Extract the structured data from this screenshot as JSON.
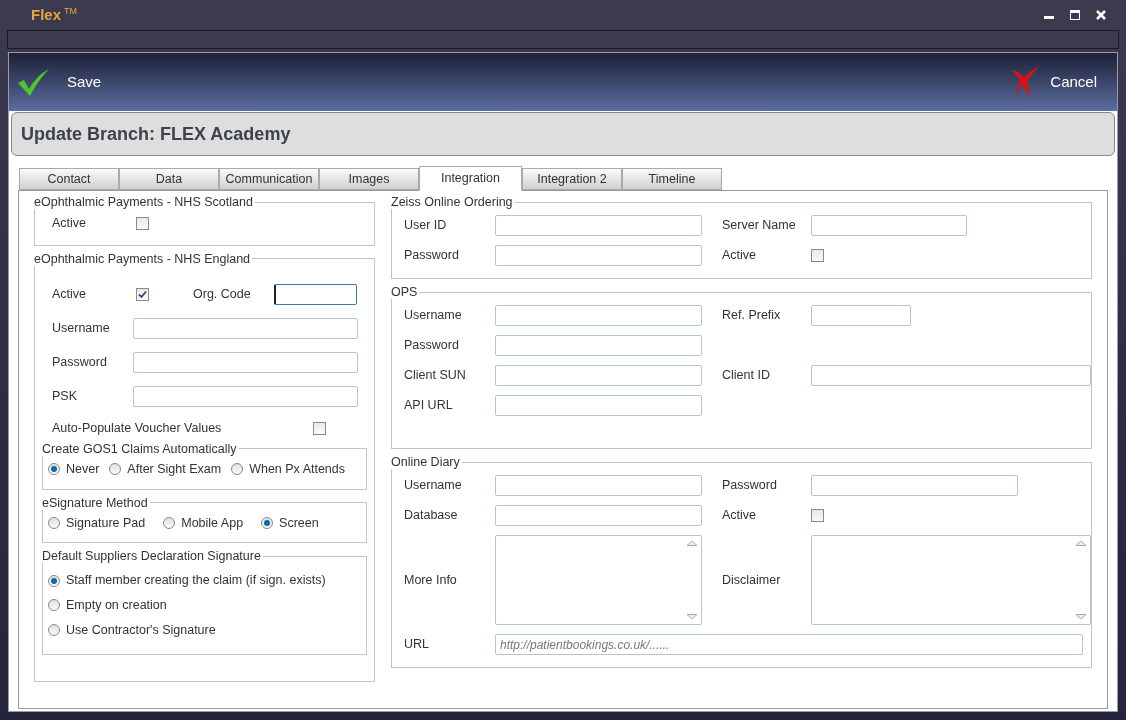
{
  "window": {
    "title": "Flex",
    "trademark": "TM"
  },
  "toolbar": {
    "save": "Save",
    "cancel": "Cancel"
  },
  "header": "Update Branch: FLEX Academy",
  "tabs": [
    {
      "label": "Contact",
      "selected": false
    },
    {
      "label": "Data",
      "selected": false
    },
    {
      "label": "Communication",
      "selected": false
    },
    {
      "label": "Images",
      "selected": false
    },
    {
      "label": "Integration",
      "selected": true
    },
    {
      "label": "Integration 2",
      "selected": false
    },
    {
      "label": "Timeline",
      "selected": false
    }
  ],
  "nhs_scotland": {
    "title": "eOphthalmic Payments - NHS Scotland",
    "active": {
      "label": "Active",
      "checked": false
    }
  },
  "nhs_england": {
    "title": "eOphthalmic Payments - NHS England",
    "active": {
      "label": "Active",
      "checked": true
    },
    "org_code": {
      "label": "Org. Code",
      "focused": true
    },
    "fields": [
      {
        "label": "Username",
        "focused": false
      },
      {
        "label": "Password",
        "focused": false
      },
      {
        "label": "PSK",
        "focused": false
      }
    ],
    "auto_populate": {
      "label": "Auto-Populate Voucher Values",
      "checked": false
    },
    "gos1": {
      "title": "Create GOS1 Claims Automatically",
      "options": [
        {
          "label": "Never",
          "selected": true
        },
        {
          "label": "After Sight Exam",
          "selected": false
        },
        {
          "label": "When Px Attends",
          "selected": false
        }
      ]
    },
    "esignature": {
      "title": "eSignature Method",
      "options": [
        {
          "label": "Signature Pad",
          "selected": false
        },
        {
          "label": "Mobile App",
          "selected": false
        },
        {
          "label": "Screen",
          "selected": true
        }
      ]
    },
    "declaration": {
      "title": "Default Suppliers Declaration Signature",
      "options": [
        {
          "label": "Staff member creating the claim (if sign. exists)",
          "selected": true
        },
        {
          "label": "Empty on creation",
          "selected": false
        },
        {
          "label": "Use Contractor's Signature",
          "selected": false
        }
      ]
    }
  },
  "zeiss": {
    "title": "Zeiss Online Ordering",
    "rows": [
      [
        {
          "label": "User ID",
          "kind": "field"
        },
        {
          "label": "Server Name",
          "kind": "field"
        }
      ],
      [
        {
          "label": "Password",
          "kind": "field"
        },
        {
          "label": "Active",
          "kind": "checkbox",
          "checked": false
        }
      ]
    ]
  },
  "ops": {
    "title": "OPS",
    "rows": [
      [
        {
          "label": "Username",
          "kind": "field"
        },
        {
          "label": "Ref. Prefix",
          "kind": "field"
        }
      ],
      [
        {
          "label": "Password",
          "kind": "field"
        }
      ],
      [
        {
          "label": "Client SUN",
          "kind": "field"
        },
        {
          "label": "Client ID",
          "kind": "field"
        }
      ],
      [
        {
          "label": "API URL",
          "kind": "field"
        }
      ]
    ]
  },
  "online_diary": {
    "title": "Online Diary",
    "rows": [
      [
        {
          "label": "Username",
          "kind": "field"
        },
        {
          "label": "Password",
          "kind": "field"
        }
      ],
      [
        {
          "label": "Database",
          "kind": "field"
        },
        {
          "label": "Active",
          "kind": "checkbox",
          "checked": false
        }
      ],
      [
        {
          "label": "More Info",
          "kind": "textarea"
        },
        {
          "label": "Disclaimer",
          "kind": "textarea"
        }
      ]
    ],
    "url": {
      "label": "URL",
      "placeholder": "http://patientbookings.co.uk/......"
    }
  }
}
